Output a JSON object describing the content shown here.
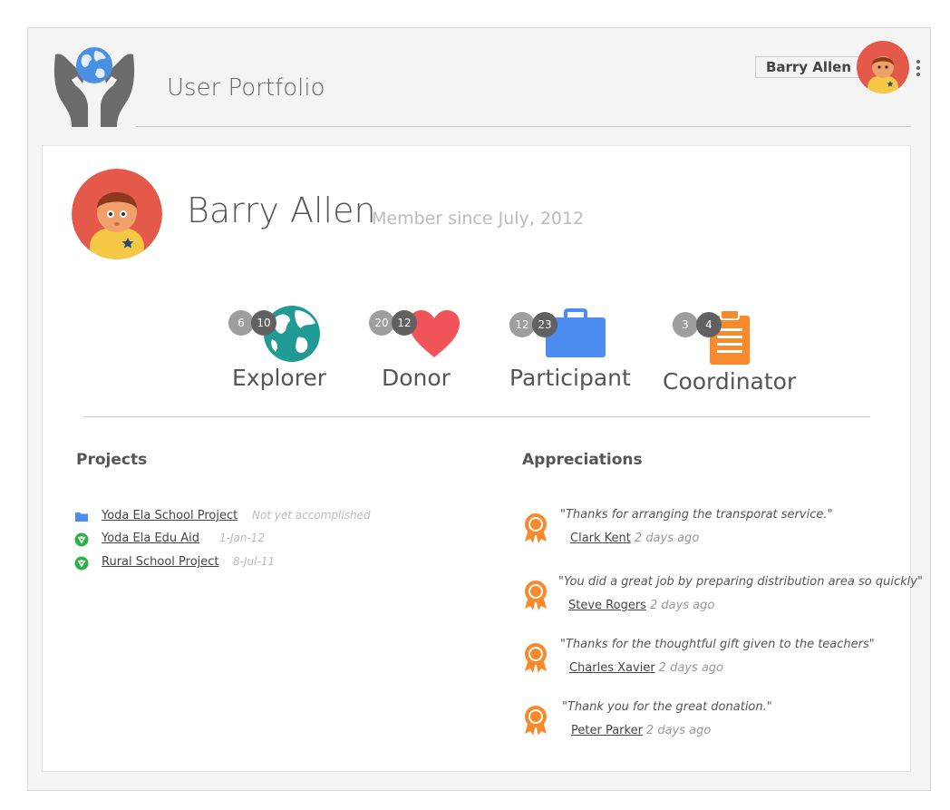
{
  "header": {
    "app_title": "User Portfolio",
    "user_name": "Barry Allen"
  },
  "profile": {
    "name": "Barry Allen",
    "member_since": "Member since July, 2012"
  },
  "badges": [
    {
      "label": "Explorer",
      "count_a": "6",
      "count_b": "10",
      "icon": "globe-icon",
      "color": "#1f9a94"
    },
    {
      "label": "Donor",
      "count_a": "20",
      "count_b": "12",
      "icon": "heart-icon",
      "color": "#f05458"
    },
    {
      "label": "Participant",
      "count_a": "12",
      "count_b": "23",
      "icon": "briefcase-icon",
      "color": "#4d8df2"
    },
    {
      "label": "Coordinator",
      "count_a": "3",
      "count_b": "4",
      "icon": "clipboard-icon",
      "color": "#f98a2c"
    }
  ],
  "projects": {
    "title": "Projects",
    "items": [
      {
        "name": "Yoda Ela School Project",
        "meta": "Not yet accomplished",
        "icon": "folder-icon"
      },
      {
        "name": "Yoda Ela Edu Aid",
        "meta": "1-Jan-12",
        "icon": "done-badge-icon"
      },
      {
        "name": "Rural School Project",
        "meta": "8-Jul-11",
        "icon": "done-badge-icon"
      }
    ]
  },
  "appreciations": {
    "title": "Appreciations",
    "items": [
      {
        "quote": "\"Thanks for arranging the transporat service.\"",
        "author": "Clark Kent",
        "time": "2 days ago"
      },
      {
        "quote": "\"You did a great job by preparing distribution area so quickly\"",
        "author": "Steve Rogers",
        "time": "2 days ago"
      },
      {
        "quote": "\"Thanks for the thoughtful gift given to the teachers\"",
        "author": "Charles Xavier",
        "time": "2 days ago"
      },
      {
        "quote": "\"Thank you for the great donation.\"",
        "author": "Peter Parker",
        "time": "2 days ago"
      }
    ]
  },
  "colors": {
    "avatar_bg": "#e4594a",
    "avatar_shirt": "#f5c846",
    "medal": "#f98a2c",
    "project_done": "#2db24a",
    "project_folder": "#4d8df2"
  }
}
